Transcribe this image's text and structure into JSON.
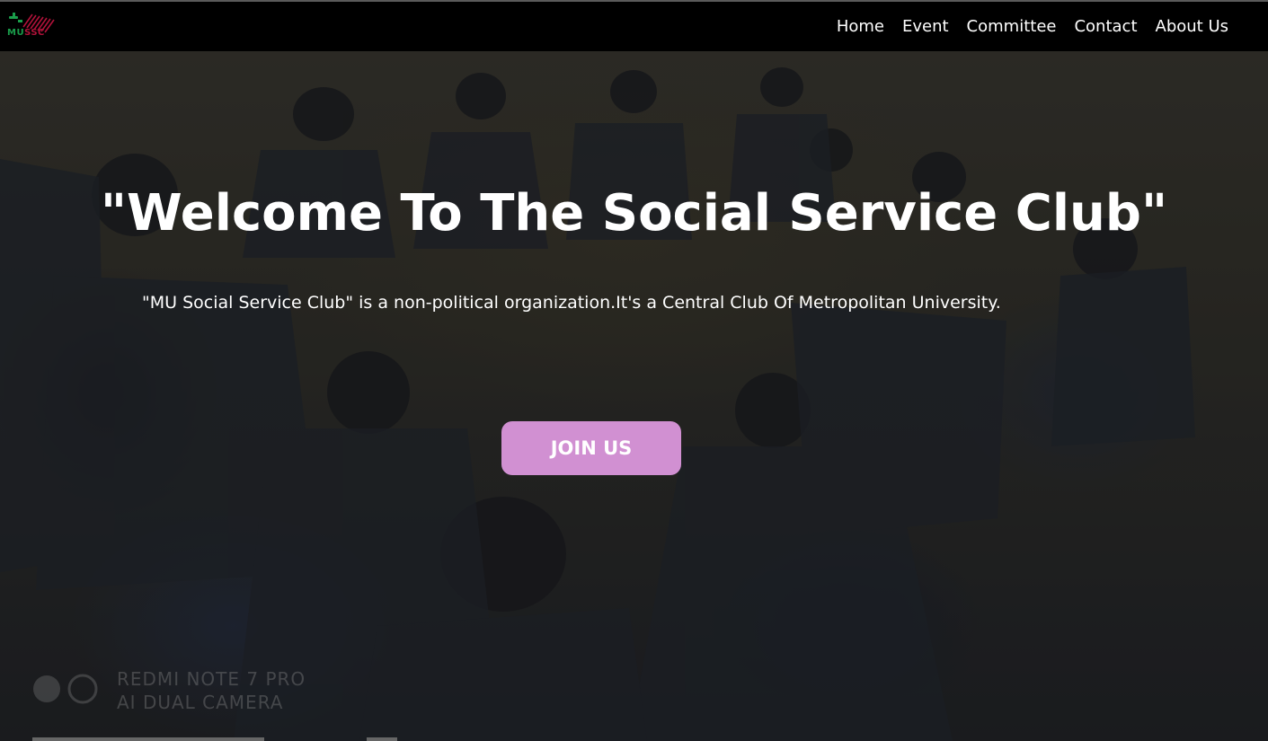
{
  "logo": {
    "mu_text": "MU",
    "ssc_text": "SSC",
    "colors": {
      "green": "#1a9e4b",
      "red": "#b1123a"
    }
  },
  "nav": {
    "items": [
      {
        "label": "Home"
      },
      {
        "label": "Event"
      },
      {
        "label": "Committee"
      },
      {
        "label": "Contact"
      },
      {
        "label": "About Us"
      }
    ]
  },
  "hero": {
    "title": "\"Welcome To The Social Service Club\"",
    "subtitle": "\"MU Social Service Club\" is a non-political organization.It's a Central Club Of Metropolitan University.",
    "button_label": "JOIN US",
    "button_color": "#d190d2",
    "watermark_line1": "REDMI NOTE 7 PRO",
    "watermark_line2": "AI DUAL CAMERA"
  }
}
